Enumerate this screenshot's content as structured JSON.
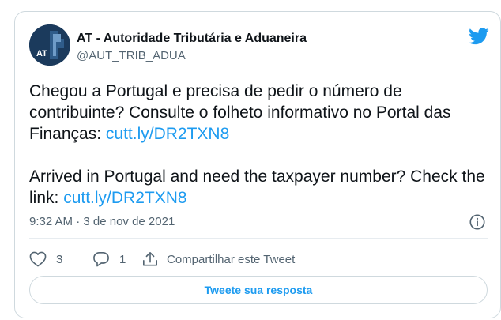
{
  "author": {
    "name": "AT - Autoridade Tributária e Aduaneira",
    "handle": "@AUT_TRIB_ADUA",
    "avatar_text": "AT"
  },
  "tweet": {
    "pt_text": "Chegou a Portugal e precisa de pedir o número de contribuinte? Consulte o folheto informativo no Portal das Finanças: ",
    "pt_link": "cutt.ly/DR2TXN8",
    "en_text": "Arrived in Portugal and need the taxpayer number? Check the link: ",
    "en_link": "cutt.ly/DR2TXN8"
  },
  "meta": {
    "timestamp": "9:32 AM · 3 de nov de 2021"
  },
  "actions": {
    "likes": "3",
    "replies": "1",
    "share_label": "Compartilhar este Tweet"
  },
  "reply_button_label": "Tweete sua resposta",
  "colors": {
    "link": "#1d9bf0",
    "secondary_text": "#536471",
    "border": "#cfd9de",
    "avatar_bg": "#1b3a5c"
  }
}
